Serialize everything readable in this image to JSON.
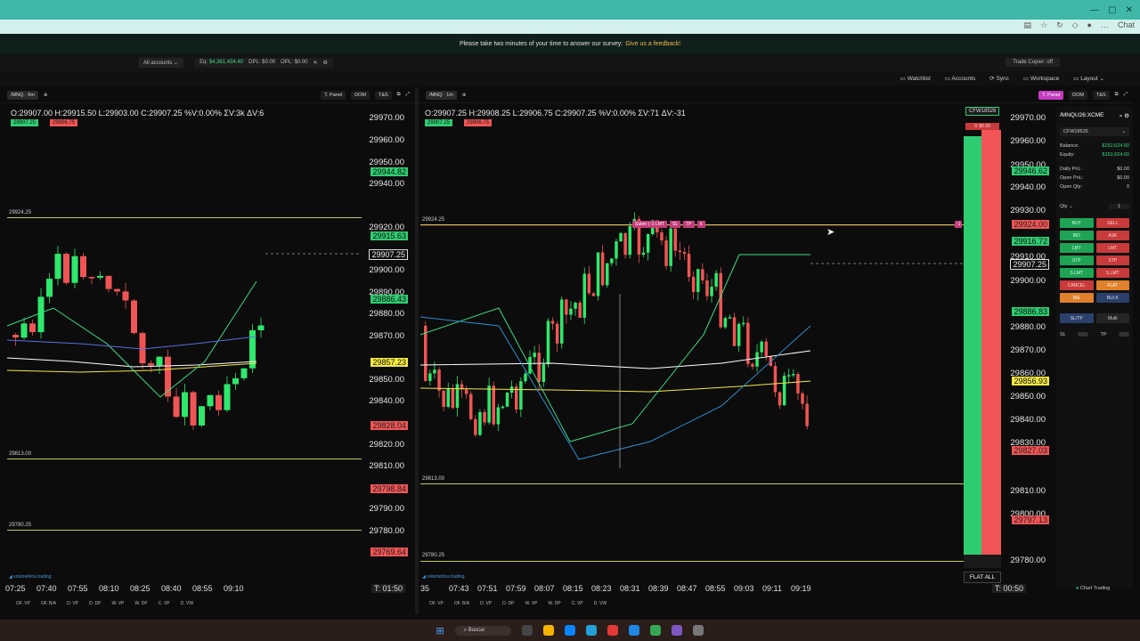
{
  "survey": {
    "text": "Please take two minutes of your time to answer our survey:",
    "link": "Give us a feedback!"
  },
  "toolbar": {
    "accounts": "All accounts",
    "eq_label": "Eq:",
    "eq_value": "$4,361,434.40",
    "dpl": "DPL: $0.00",
    "opl": "OPL: $0.00",
    "trade_copier": "Trade Copier: off"
  },
  "topnav": {
    "watchlist": "Watchlist",
    "accounts": "Accounts",
    "sync": "Sync",
    "workspace": "Workspace",
    "layout": "Layout"
  },
  "left_chart": {
    "symbol": "/MNQ",
    "interval": "5m",
    "tpanel": "T. Panel",
    "dom": "DOM",
    "ts": "T&S",
    "ohlc": "O:29907.00 H:29915.50 L:29903.00 C:29907.25 %V:0.00% ΣV:3k ΔV:6",
    "chip_bid": "29907.25",
    "chip_ask": "29906.75",
    "prices": [
      "29970.00",
      "29960.00",
      "29950.00",
      "29940.00",
      "29920.00",
      "29900.00",
      "29890.00",
      "29880.00",
      "29870.00",
      "29850.00",
      "29840.00",
      "29820.00",
      "29810.00",
      "29790.00",
      "29780.00"
    ],
    "tags": {
      "t1": "29944.82",
      "t2": "29915.63",
      "cur": "29907.25",
      "t3": "29886.43",
      "y": "29857.23",
      "r1": "29828.04",
      "r2": "29798.84",
      "r3": "29769.64"
    },
    "levels": {
      "hi": "29924.25",
      "lo": "29813.00",
      "lo2": "29780.25"
    },
    "times": [
      "07:25",
      "07:40",
      "07:55",
      "08:10",
      "08:25",
      "08:40",
      "08:55",
      "09:10"
    ],
    "timer": "T: 01:50",
    "watermark": "volumetrica trading"
  },
  "right_chart": {
    "symbol": "/MNQ",
    "interval": "1m",
    "tpanel": "T. Panel",
    "dom": "DOM",
    "ts": "T&S",
    "ohlc": "O:29907.25 H:29908.25 L:29906.75 C:29907.25 %V:0.00% ΣV:71 ΔV:-31",
    "chip_bid": "29907.25",
    "chip_ask": "29906.75",
    "prices": [
      "29970.00",
      "29960.00",
      "29950.00",
      "29940.00",
      "29930.00",
      "29910.00",
      "29900.00",
      "29880.00",
      "29870.00",
      "29860.00",
      "29850.00",
      "29840.00",
      "29830.00",
      "29810.00",
      "29800.00",
      "29780.00"
    ],
    "tags": {
      "t1": "29946.62",
      "r0": "29924.00",
      "t2": "29916.72",
      "cur": "29907.25",
      "t3": "29886.83",
      "y": "29856.93",
      "r1": "29827.03",
      "r2": "29797.13"
    },
    "levels": {
      "hi": "29924.25",
      "lo": "29813.00",
      "lo2": "29780.25"
    },
    "order_line": {
      "submit": "Subm | -1 LMT",
      "sl": "SL",
      "tp": "TP",
      "x": "X",
      "qty": "-1"
    },
    "times": [
      "35",
      "07:43",
      "07:51",
      "07:59",
      "08:07",
      "08:15",
      "08:23",
      "08:31",
      "08:39",
      "08:47",
      "08:55",
      "09:03",
      "09:11",
      "09:19"
    ],
    "timer": "T: 00:50",
    "account_tag": "CFW18526",
    "ob_pnl": "0: $0.00",
    "flat_all": "FLAT ALL"
  },
  "order_panel": {
    "symbol": "/MNQU26:XCME",
    "account": "CFW18526",
    "balance_label": "Balance:",
    "balance": "$152,624.60",
    "equity_label": "Equity:",
    "equity": "$152,624.60",
    "daily_label": "Daily PnL:",
    "daily": "$0.00",
    "open_label": "Open PnL:",
    "open": "$0.00",
    "qty_label": "Open Qty:",
    "qty": "0",
    "qty_sel": "Qty",
    "qty_val": "1",
    "buttons": [
      "BUY",
      "SELL",
      "BID",
      "ASK",
      "LMT",
      "LMT",
      "STP",
      "STP",
      "S.LMT",
      "S.LMT",
      "CANCEL",
      "FLAT",
      "B/E",
      "BULK"
    ],
    "sltp": "SL/TP",
    "multi": "Multi",
    "sl": "SL",
    "tp": "TP",
    "footer": "Chart Trading"
  },
  "bottom_tabs": [
    "OF. VP",
    "OF. B/A",
    "D. VP",
    "D. DP",
    "W. VP",
    "W. DP",
    "C. VP",
    "D. VW"
  ],
  "taskbar": {
    "search": "Buscar"
  }
}
